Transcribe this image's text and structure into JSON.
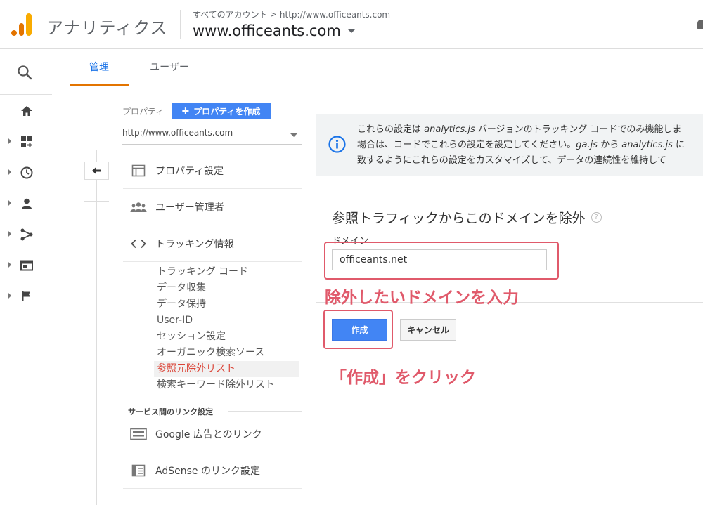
{
  "header": {
    "app_title": "アナリティクス",
    "breadcrumb_root": "すべてのアカウント",
    "breadcrumb_separator": ">",
    "breadcrumb_account": "http://www.officeants.com",
    "account_name": "www.officeants.com"
  },
  "tabs": {
    "admin": "管理",
    "user": "ユーザー"
  },
  "property": {
    "label": "プロパティ",
    "create_button": "プロパティを作成",
    "selected": "http://www.officeants.com"
  },
  "nav": {
    "property_settings": "プロパティ設定",
    "user_management": "ユーザー管理者",
    "tracking_info": "トラッキング情報",
    "sub_items": {
      "tracking_code": "トラッキング コード",
      "data_collection": "データ収集",
      "data_retention": "データ保持",
      "user_id": "User-ID",
      "session_settings": "セッション設定",
      "organic_sources": "オーガニック検索ソース",
      "referral_exclusion": "参照元除外リスト",
      "search_term_exclusion": "検索キーワード除外リスト"
    },
    "link_section_label": "サービス間のリンク設定",
    "google_ads": "Google 広告とのリンク",
    "adsense": "AdSense のリンク設定"
  },
  "info": {
    "line1_a": "これらの設定は ",
    "line1_b": "analytics.js",
    "line1_c": " バージョンのトラッキング コードでのみ機能しま",
    "line2_a": "場合は、コードでこれらの設定を設定してください。",
    "line2_b": "ga.js",
    "line2_c": " から ",
    "line2_d": "analytics.js",
    "line2_e": " に",
    "line3": "致するようにこれらの設定をカスタマイズして、データの連続性を維持して"
  },
  "form": {
    "title": "参照トラフィックからこのドメインを除外",
    "help": "?",
    "domain_label": "ドメイン",
    "domain_value": "officeants.net",
    "create_button": "作成",
    "cancel_button": "キャンセル"
  },
  "annotations": {
    "input_hint": "除外したいドメインを入力",
    "click_hint": "「作成」をクリック"
  },
  "colors": {
    "accent_blue": "#4285f4",
    "tab_underline": "#e37400",
    "annotation": "#e05a6b",
    "active_nav": "#db4437"
  }
}
